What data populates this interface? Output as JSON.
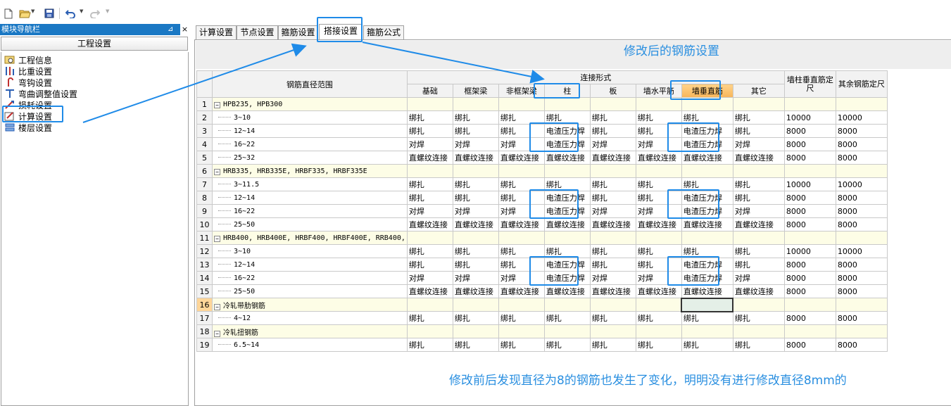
{
  "toolbar": {
    "icons": [
      "new-file-icon",
      "open-folder-icon",
      "save-icon",
      "undo-icon",
      "redo-icon"
    ]
  },
  "nav": {
    "title": "模块导航栏",
    "pin": "⊿",
    "close": "×",
    "header": "工程设置",
    "items": [
      {
        "label": "工程信息",
        "icon": "project-info-icon"
      },
      {
        "label": "比重设置",
        "icon": "density-icon"
      },
      {
        "label": "弯钩设置",
        "icon": "hook-icon"
      },
      {
        "label": "弯曲调整值设置",
        "icon": "bend-adjust-icon"
      },
      {
        "label": "损耗设置",
        "icon": "loss-icon"
      },
      {
        "label": "计算设置",
        "icon": "calc-settings-icon"
      },
      {
        "label": "楼层设置",
        "icon": "floor-settings-icon"
      }
    ]
  },
  "tabs": [
    {
      "label": "计算设置"
    },
    {
      "label": "节点设置"
    },
    {
      "label": "箍筋设置"
    },
    {
      "label": "搭接设置"
    },
    {
      "label": "箍筋公式"
    }
  ],
  "grid": {
    "range_header": "钢筋直径范围",
    "connect_header": "连接形式",
    "columns": [
      "基础",
      "框架梁",
      "非框架梁",
      "柱",
      "板",
      "墙水平筋",
      "墙垂直筋",
      "其它"
    ],
    "extra_columns": [
      "墙柱垂直筋定尺",
      "其余钢筋定尺"
    ],
    "rows": [
      {
        "num": "1",
        "group": true,
        "label": "HPB235, HPB300"
      },
      {
        "num": "2",
        "label": "3~10",
        "cells": [
          "绑扎",
          "绑扎",
          "绑扎",
          "绑扎",
          "绑扎",
          "绑扎",
          "绑扎",
          "绑扎",
          "10000",
          "10000"
        ]
      },
      {
        "num": "3",
        "label": "12~14",
        "cells": [
          "绑扎",
          "绑扎",
          "绑扎",
          "电渣压力焊",
          "绑扎",
          "绑扎",
          "电渣压力焊",
          "绑扎",
          "8000",
          "8000"
        ]
      },
      {
        "num": "4",
        "label": "16~22",
        "cells": [
          "对焊",
          "对焊",
          "对焊",
          "电渣压力焊",
          "对焊",
          "对焊",
          "电渣压力焊",
          "对焊",
          "8000",
          "8000"
        ]
      },
      {
        "num": "5",
        "label": "25~32",
        "cells": [
          "直螺纹连接",
          "直螺纹连接",
          "直螺纹连接",
          "直螺纹连接",
          "直螺纹连接",
          "直螺纹连接",
          "直螺纹连接",
          "直螺纹连接",
          "8000",
          "8000"
        ]
      },
      {
        "num": "6",
        "group": true,
        "label": "HRB335, HRB335E, HRBF335, HRBF335E"
      },
      {
        "num": "7",
        "label": "3~11.5",
        "cells": [
          "绑扎",
          "绑扎",
          "绑扎",
          "绑扎",
          "绑扎",
          "绑扎",
          "绑扎",
          "绑扎",
          "10000",
          "10000"
        ]
      },
      {
        "num": "8",
        "label": "12~14",
        "cells": [
          "绑扎",
          "绑扎",
          "绑扎",
          "电渣压力焊",
          "绑扎",
          "绑扎",
          "电渣压力焊",
          "绑扎",
          "8000",
          "8000"
        ]
      },
      {
        "num": "9",
        "label": "16~22",
        "cells": [
          "对焊",
          "对焊",
          "对焊",
          "电渣压力焊",
          "对焊",
          "对焊",
          "电渣压力焊",
          "对焊",
          "8000",
          "8000"
        ]
      },
      {
        "num": "10",
        "label": "25~50",
        "cells": [
          "直螺纹连接",
          "直螺纹连接",
          "直螺纹连接",
          "直螺纹连接",
          "直螺纹连接",
          "直螺纹连接",
          "直螺纹连接",
          "直螺纹连接",
          "8000",
          "8000"
        ]
      },
      {
        "num": "11",
        "group": true,
        "label": "HRB400, HRB400E, HRBF400, HRBF400E, RRB400,"
      },
      {
        "num": "12",
        "label": "3~10",
        "cells": [
          "绑扎",
          "绑扎",
          "绑扎",
          "绑扎",
          "绑扎",
          "绑扎",
          "绑扎",
          "绑扎",
          "10000",
          "10000"
        ]
      },
      {
        "num": "13",
        "label": "12~14",
        "cells": [
          "绑扎",
          "绑扎",
          "绑扎",
          "电渣压力焊",
          "绑扎",
          "绑扎",
          "电渣压力焊",
          "绑扎",
          "8000",
          "8000"
        ]
      },
      {
        "num": "14",
        "label": "16~22",
        "cells": [
          "对焊",
          "对焊",
          "对焊",
          "电渣压力焊",
          "对焊",
          "对焊",
          "电渣压力焊",
          "对焊",
          "8000",
          "8000"
        ]
      },
      {
        "num": "15",
        "label": "25~50",
        "cells": [
          "直螺纹连接",
          "直螺纹连接",
          "直螺纹连接",
          "直螺纹连接",
          "直螺纹连接",
          "直螺纹连接",
          "直螺纹连接",
          "直螺纹连接",
          "8000",
          "8000"
        ]
      },
      {
        "num": "16",
        "group": true,
        "selected": true,
        "label": "冷轧带肋钢筋"
      },
      {
        "num": "17",
        "label": "4~12",
        "cells": [
          "绑扎",
          "绑扎",
          "绑扎",
          "绑扎",
          "绑扎",
          "绑扎",
          "绑扎",
          "绑扎",
          "8000",
          "8000"
        ]
      },
      {
        "num": "18",
        "group": true,
        "label": "冷轧扭钢筋"
      },
      {
        "num": "19",
        "label": "6.5~14",
        "cells": [
          "绑扎",
          "绑扎",
          "绑扎",
          "绑扎",
          "绑扎",
          "绑扎",
          "绑扎",
          "绑扎",
          "8000",
          "8000"
        ]
      }
    ]
  },
  "annotations": {
    "title": "修改后的钢筋设置",
    "note": "修改前后发现直径为8的钢筋也发生了变化，明明没有进行修改直径8mm的",
    "accent": "#1f8be8"
  }
}
